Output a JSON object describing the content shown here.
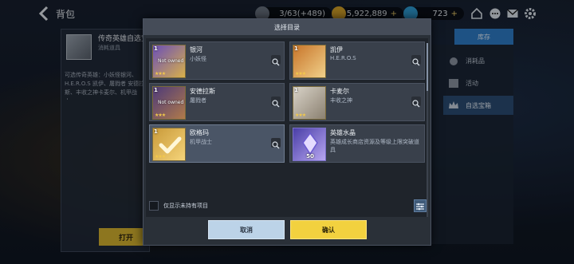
{
  "topbar": {
    "title": "背包",
    "stamina": "3/63(+489)",
    "gold": "5,922,889",
    "gems": "723"
  },
  "background": {
    "item_title": "传奇英雄自选宝箱",
    "item_subtitle": "消耗道具",
    "item_desc": "可选传奇英雄：小妖怪银河、H.E.R.O.S 凯伊、屠戮者 安德拉斯、丰收之神卡麦尔、机甲战士…",
    "open_button": "打开",
    "right_top_button": "库存",
    "right_items": [
      "消耗品",
      "活动",
      "自选宝箱"
    ]
  },
  "modal": {
    "title": "选择目录",
    "cards": [
      {
        "level": "1",
        "name": "银河",
        "subtitle": "小妖怪",
        "stars": "★★★",
        "portrait": "Not owned",
        "colors": [
          "#6a4fb8",
          "#d9b04a"
        ]
      },
      {
        "level": "1",
        "name": "凯伊",
        "subtitle": "H.E.R.O.S",
        "stars": "★★★",
        "colors": [
          "#c8752a",
          "#f0d08a"
        ]
      },
      {
        "level": "1",
        "name": "安德拉斯",
        "subtitle": "屠戮者",
        "stars": "★★★",
        "portrait": "Not owned",
        "colors": [
          "#4d3a7a",
          "#b07a4a"
        ]
      },
      {
        "level": "1",
        "name": "卡麦尔",
        "subtitle": "丰收之神",
        "stars": "★★★",
        "colors": [
          "#d9d3c8",
          "#8a8070"
        ]
      },
      {
        "level": "1",
        "name": "欧格玛",
        "subtitle": "机甲战士",
        "stars": "★★★",
        "colors": [
          "#c99a3a",
          "#f5d47a"
        ]
      },
      {
        "name": "英雄水晶",
        "desc": "英雄成长商店资源及等级上限突破道具",
        "qty": "50",
        "colors": [
          "#4a3fa8",
          "#b7a6f0"
        ]
      }
    ],
    "filter_label": "仅显示未持有项目",
    "cancel_label": "取消",
    "confirm_label": "确认"
  }
}
